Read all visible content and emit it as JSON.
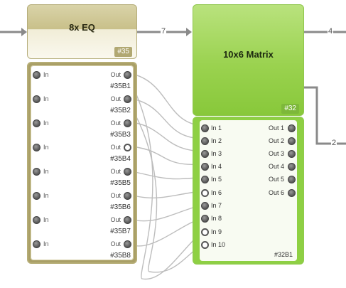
{
  "eq_module": {
    "title": "8x EQ",
    "tag": "#35",
    "rows": [
      {
        "in": "In",
        "out": "Out",
        "sub": "#35B1"
      },
      {
        "in": "In",
        "out": "Out",
        "sub": "#35B2"
      },
      {
        "in": "In",
        "out": "Out",
        "sub": "#35B3"
      },
      {
        "in": "In",
        "out": "Out",
        "sub": "#35B4"
      },
      {
        "in": "In",
        "out": "Out",
        "sub": "#35B5"
      },
      {
        "in": "In",
        "out": "Out",
        "sub": "#35B6"
      },
      {
        "in": "In",
        "out": "Out",
        "sub": "#35B7"
      },
      {
        "in": "In",
        "out": "Out",
        "sub": "#35B8"
      }
    ]
  },
  "matrix_module": {
    "title": "10x6 Matrix",
    "tag": "#32",
    "sub_tag": "#32B1",
    "inputs": [
      "In 1",
      "In 2",
      "In 3",
      "In 4",
      "In 5",
      "In 6",
      "In 7",
      "In 8",
      "In 9",
      "In 10"
    ],
    "outputs": [
      "Out 1",
      "Out 2",
      "Out 3",
      "Out 4",
      "Out 5",
      "Out 6"
    ]
  },
  "connections": {
    "eq_to_matrix": "7",
    "matrix_out": "4",
    "matrix_side": "2"
  }
}
